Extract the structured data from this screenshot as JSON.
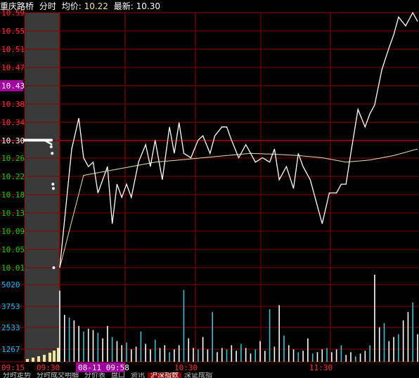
{
  "header": {
    "stock_name": "重庆路桥",
    "mode": "分时",
    "avg_label": "均价:",
    "avg_value": "10.22",
    "latest_label": "最新:",
    "latest_value": "10.30"
  },
  "colors": {
    "background": "#000000",
    "grid": "#8b0000",
    "price_line": "#ffffff",
    "avg_line": "#e8e0a0",
    "up_label": "#ff3030",
    "down_label": "#00d000",
    "prev_close_label": "#ffffff",
    "volume_label": "#00bfff",
    "volume_bar_pre": "#f0e6a0",
    "volume_bar_up": "#ffffff",
    "volume_bar_down": "#40c0d0",
    "time_label": "#ff3030",
    "cursor_bg": "#a000a0",
    "pre_open_shade": "#3a3a3a"
  },
  "price_axis": {
    "labels": [
      "10.59",
      "10.55",
      "10.51",
      "10.47",
      "10.43",
      "10.38",
      "10.34",
      "10.30",
      "10.26",
      "10.22",
      "10.18",
      "10.13",
      "10.09",
      "10.05",
      "10.01"
    ],
    "highlight": "10.43",
    "prev_close": "10.30"
  },
  "volume_axis": {
    "labels": [
      "5020",
      "3753",
      "2533",
      "1267"
    ]
  },
  "time_axis": {
    "labels": [
      "09:15",
      "09:30",
      "10:30",
      "11:30"
    ],
    "cursor": "08-11 09:58"
  },
  "chart_data": {
    "type": "line",
    "series": [
      {
        "name": "",
        "t": [
          0,
          5,
          8,
          10,
          12,
          14,
          16,
          20,
          22,
          24,
          26,
          28,
          30,
          33,
          36,
          38,
          40,
          43,
          46,
          48,
          50,
          52,
          55,
          58,
          60,
          63,
          65,
          68,
          70,
          72,
          75,
          78,
          80,
          82,
          85,
          88,
          90,
          92,
          95,
          98,
          100,
          102,
          105,
          108,
          110,
          113,
          116,
          118,
          120,
          122,
          125,
          128,
          130,
          132,
          135,
          138,
          140,
          142,
          145,
          148,
          150
        ],
        "values": [
          10.01,
          10.28,
          10.35,
          10.26,
          10.24,
          10.25,
          10.18,
          10.24,
          10.11,
          10.2,
          10.17,
          10.2,
          10.17,
          10.25,
          10.29,
          10.24,
          10.3,
          10.21,
          10.33,
          10.27,
          10.34,
          10.27,
          10.26,
          10.3,
          10.31,
          10.27,
          10.31,
          10.33,
          10.33,
          10.3,
          10.26,
          10.29,
          10.27,
          10.25,
          10.26,
          10.25,
          10.28,
          10.21,
          10.24,
          10.19,
          10.27,
          10.24,
          10.21,
          10.15,
          10.11,
          10.18,
          10.18,
          10.2,
          10.2,
          10.27,
          10.37,
          10.33,
          10.36,
          10.38,
          10.46,
          10.51,
          10.54,
          10.58,
          10.56,
          10.59,
          10.57
        ]
      },
      {
        "name": "",
        "t": [
          0,
          10,
          20,
          30,
          40,
          50,
          60,
          70,
          80,
          90,
          100,
          110,
          120,
          130,
          140,
          150
        ],
        "values": [
          10.01,
          10.22,
          10.23,
          10.24,
          10.25,
          10.255,
          10.26,
          10.265,
          10.27,
          10.268,
          10.265,
          10.26,
          10.25,
          10.255,
          10.265,
          10.28
        ]
      }
    ],
    "pre_open": {
      "t": [
        -15,
        -10,
        -5,
        -1
      ],
      "values": [
        10.3,
        10.3,
        10.3,
        10.29
      ]
    },
    "volume": {
      "t": [
        0,
        2,
        4,
        6,
        8,
        10,
        12,
        14,
        16,
        18,
        20,
        22,
        24,
        26,
        28,
        30,
        32,
        34,
        36,
        38,
        40,
        42,
        44,
        46,
        48,
        50,
        52,
        54,
        56,
        58,
        60,
        62,
        64,
        66,
        68,
        70,
        72,
        74,
        76,
        78,
        80,
        82,
        84,
        86,
        88,
        90,
        92,
        94,
        96,
        98,
        100,
        102,
        104,
        106,
        108,
        110,
        112,
        114,
        116,
        118,
        120,
        122,
        124,
        126,
        128,
        130,
        132,
        134,
        136,
        138,
        140,
        142,
        144,
        146,
        148,
        150
      ],
      "values": [
        5150,
        3400,
        3200,
        3000,
        2600,
        2200,
        2400,
        2300,
        2100,
        1700,
        2600,
        1800,
        1500,
        1200,
        1400,
        900,
        1100,
        2200,
        1300,
        900,
        1600,
        1000,
        1200,
        700,
        900,
        1200,
        5200,
        1700,
        1000,
        900,
        1800,
        900,
        3600,
        700,
        1000,
        900,
        1200,
        800,
        1300,
        1000,
        600,
        900,
        1500,
        800,
        3800,
        1100,
        4100,
        1900,
        1200,
        900,
        700,
        800,
        1700,
        600,
        700,
        900,
        1000,
        700,
        900,
        1200,
        500,
        700,
        400,
        600,
        800,
        1200,
        6300,
        2500,
        2800,
        1500,
        1800,
        2000,
        3000,
        3600,
        4300,
        2000
      ],
      "ylim": [
        0,
        6300
      ]
    },
    "ylim": [
      10.01,
      10.59
    ]
  },
  "tabs": [
    "分时走势",
    "分时成交明细",
    "分价表",
    "",
    "盘口",
    "",
    "资讯",
    "",
    "沪深指数",
    "",
    "深证成指"
  ]
}
